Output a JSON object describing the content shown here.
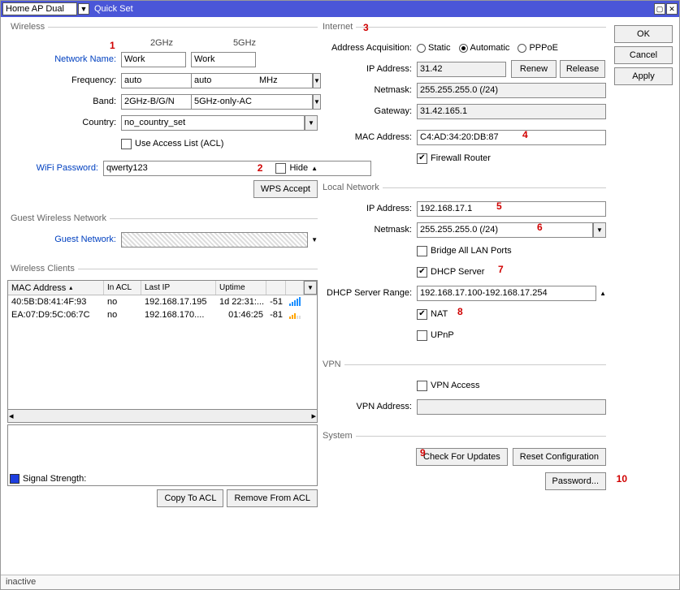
{
  "titlebar": {
    "mode": "Home AP Dual",
    "title": "Quick Set"
  },
  "buttons": {
    "ok": "OK",
    "cancel": "Cancel",
    "apply": "Apply"
  },
  "annotations": {
    "a1": "1",
    "a2": "2",
    "a3": "3",
    "a4": "4",
    "a5": "5",
    "a6": "6",
    "a7": "7",
    "a8": "8",
    "a9": "9",
    "a10": "10"
  },
  "wireless": {
    "legend": "Wireless",
    "col2g": "2GHz",
    "col5g": "5GHz",
    "network_name_lbl": "Network Name:",
    "name2g": "Work",
    "name5g": "Work",
    "frequency_lbl": "Frequency:",
    "freq2g": "auto",
    "freq5g": "auto",
    "mhz": "MHz",
    "band_lbl": "Band:",
    "band2g": "2GHz-B/G/N",
    "band5g": "5GHz-only-AC",
    "country_lbl": "Country:",
    "country": "no_country_set",
    "acl": "Use Access List (ACL)",
    "wifi_pw_lbl": "WiFi Password:",
    "wifi_pw": "qwerty123",
    "hide": "Hide",
    "wps": "WPS Accept"
  },
  "guest": {
    "legend": "Guest Wireless Network",
    "label": "Guest Network:",
    "value": ""
  },
  "clients": {
    "legend": "Wireless Clients",
    "cols": {
      "mac": "MAC Address",
      "acl": "In ACL",
      "lastip": "Last IP",
      "uptime": "Uptime",
      "sig": ""
    },
    "rows": [
      {
        "mac": "40:5B:D8:41:4F:93",
        "acl": "no",
        "ip": "192.168.17.195",
        "uptime": "1d 22:31:...",
        "sig": "-51",
        "strength": "high"
      },
      {
        "mac": "EA:07:D9:5C:06:7C",
        "acl": "no",
        "ip": "192.168.170....",
        "uptime": "01:46:25",
        "sig": "-81",
        "strength": "low"
      }
    ],
    "signal_strength": "Signal Strength:",
    "copy": "Copy To ACL",
    "remove": "Remove From ACL"
  },
  "internet": {
    "legend": "Internet",
    "acq_lbl": "Address Acquisition:",
    "static": "Static",
    "auto": "Automatic",
    "pppoe": "PPPoE",
    "ip_lbl": "IP Address:",
    "ip": "31.42",
    "renew": "Renew",
    "release": "Release",
    "netmask_lbl": "Netmask:",
    "netmask": "255.255.255.0 (/24)",
    "gateway_lbl": "Gateway:",
    "gateway": "31.42.165.1",
    "mac_lbl": "MAC Address:",
    "mac": "C4:AD:34:20:DB:87",
    "fw": "Firewall Router"
  },
  "local": {
    "legend": "Local Network",
    "ip_lbl": "IP Address:",
    "ip": "192.168.17.1",
    "netmask_lbl": "Netmask:",
    "netmask": "255.255.255.0 (/24)",
    "bridge": "Bridge All LAN Ports",
    "dhcp": "DHCP Server",
    "range_lbl": "DHCP Server Range:",
    "range": "192.168.17.100-192.168.17.254",
    "nat": "NAT",
    "upnp": "UPnP"
  },
  "vpn": {
    "legend": "VPN",
    "access": "VPN Access",
    "addr_lbl": "VPN Address:",
    "addr": ""
  },
  "system": {
    "legend": "System",
    "check": "Check For Updates",
    "reset": "Reset Configuration",
    "password": "Password..."
  },
  "footer": {
    "status": "inactive"
  }
}
